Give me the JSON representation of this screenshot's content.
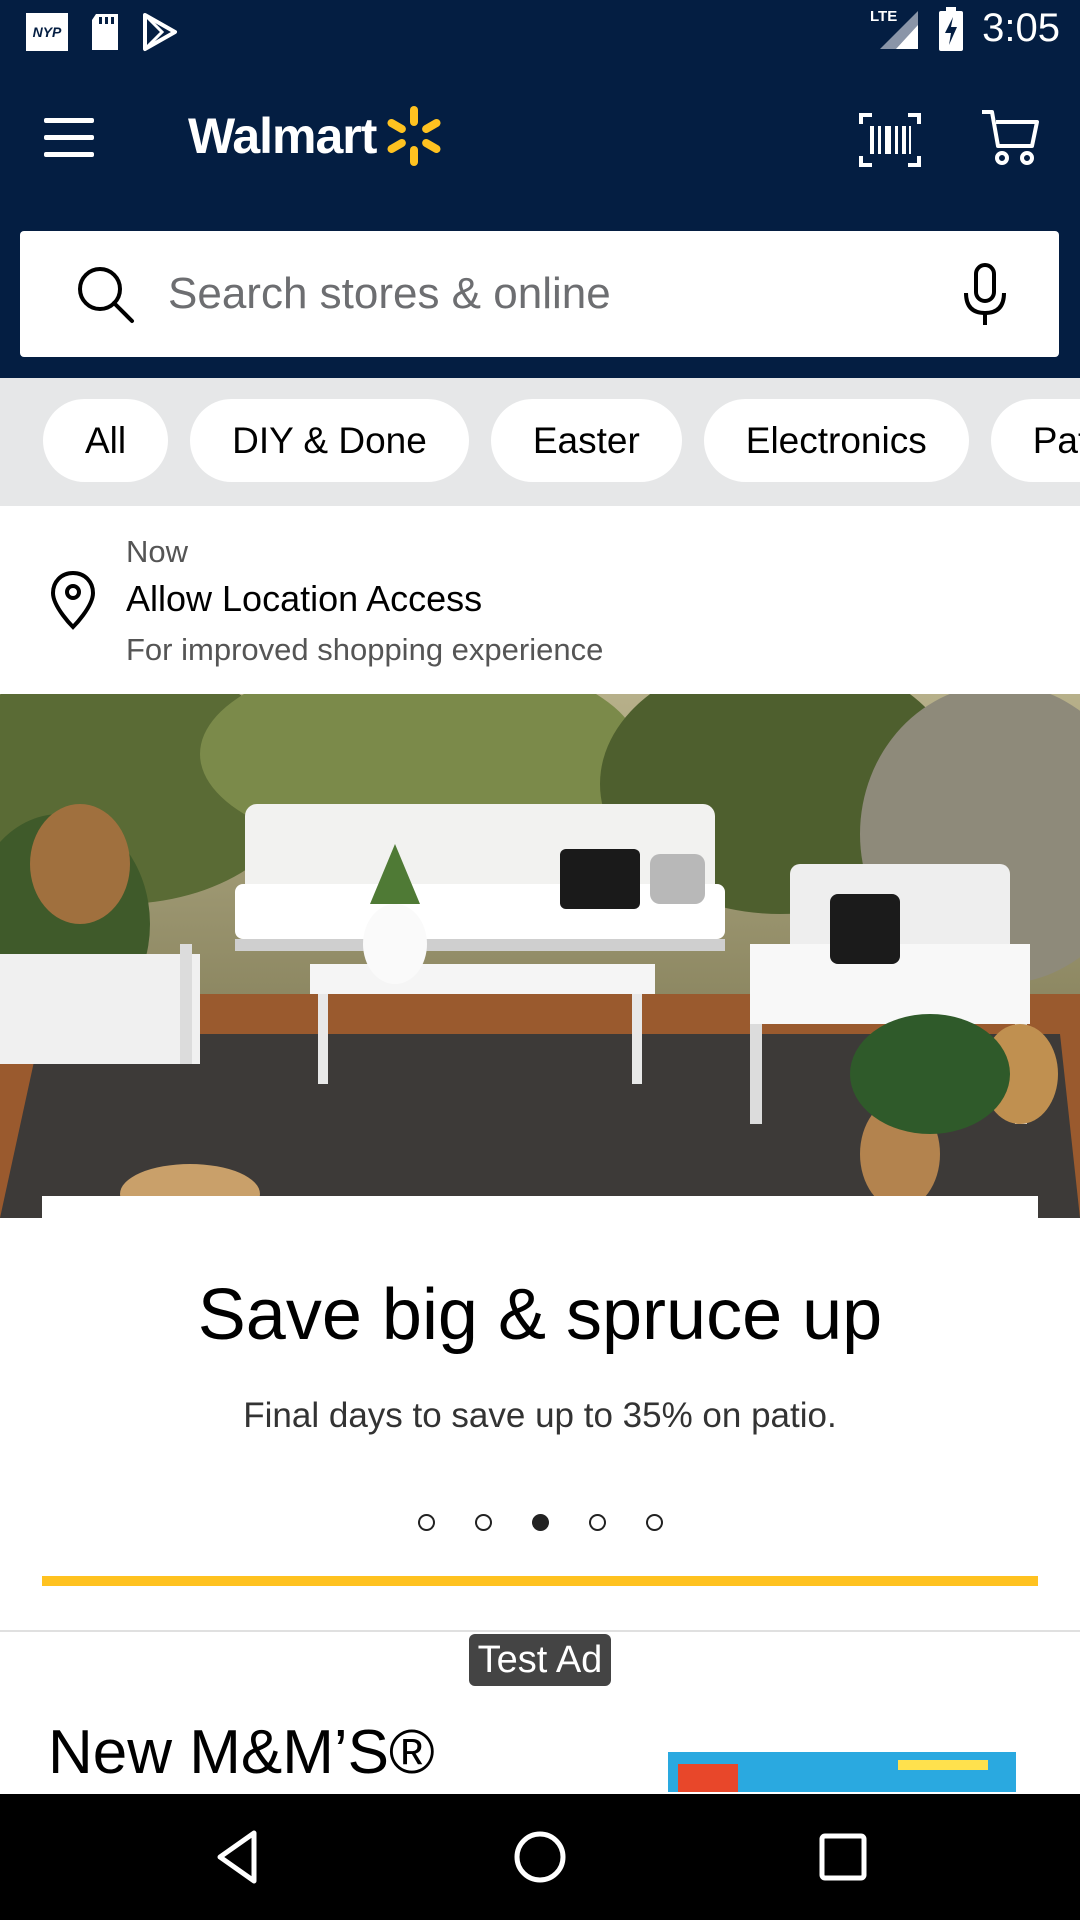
{
  "status_bar": {
    "nyp_label": "NYP",
    "network": "LTE",
    "time": "3:05"
  },
  "header": {
    "brand": "Walmart",
    "brand_spark_color": "#ffc220",
    "background_color": "#041e42"
  },
  "search": {
    "placeholder": "Search stores & online"
  },
  "chips": [
    "All",
    "DIY & Done",
    "Easter",
    "Electronics",
    "Pat"
  ],
  "location": {
    "time_label": "Now",
    "title": "Allow Location Access",
    "subtitle": "For improved shopping experience"
  },
  "hero": {
    "title": "Save big & spruce up",
    "subtitle": "Final days to save up to 35% on patio.",
    "carousel_active_index": 2,
    "carousel_count": 5,
    "accent_color": "#ffc220"
  },
  "ad": {
    "badge": "Test Ad",
    "title": "New M&M’S®"
  },
  "nav_bar": {
    "icons": [
      "back-icon",
      "home-icon",
      "recents-icon"
    ]
  }
}
